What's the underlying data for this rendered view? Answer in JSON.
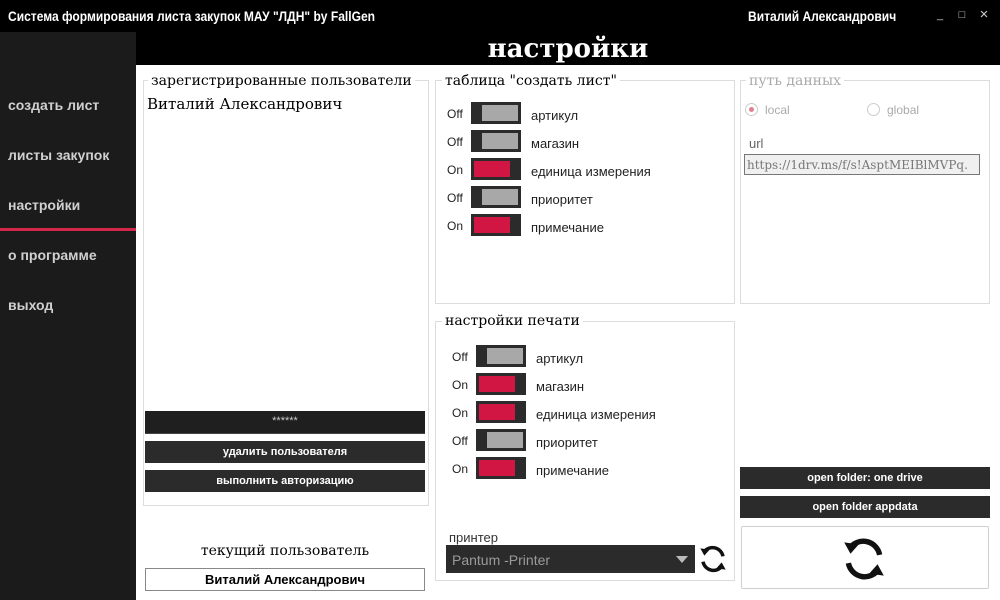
{
  "window": {
    "title": "Система формирования листа закупок МАУ \"ЛДН\" by FallGen",
    "user": "Виталий Александрович",
    "minimize": "_",
    "maximize": "□",
    "close": "×"
  },
  "sidebar": {
    "items": [
      {
        "label": "создать лист"
      },
      {
        "label": "листы закупок"
      },
      {
        "label": "настройки",
        "active": true
      },
      {
        "label": "о программе"
      },
      {
        "label": "выход"
      }
    ]
  },
  "header": {
    "title": "настройки"
  },
  "users_panel": {
    "legend": "зарегистрированные пользователи",
    "users": [
      "Виталий Александрович"
    ],
    "password_value": "******",
    "delete_button": "удалить пользователя",
    "auth_button": "выполнить авторизацию",
    "current_label": "текущий пользователь",
    "current_user": "Виталий Александрович"
  },
  "create_table": {
    "legend": "таблица \"создать лист\"",
    "rows": [
      {
        "state": "Off",
        "on": false,
        "label": "артикул"
      },
      {
        "state": "Off",
        "on": false,
        "label": "магазин"
      },
      {
        "state": "On",
        "on": true,
        "label": "единица измерения"
      },
      {
        "state": "Off",
        "on": false,
        "label": "приоритет"
      },
      {
        "state": "On",
        "on": true,
        "label": "примечание"
      }
    ]
  },
  "print_settings": {
    "legend": "настройки печати",
    "rows": [
      {
        "state": "Off",
        "on": false,
        "label": "артикул"
      },
      {
        "state": "On",
        "on": true,
        "label": "магазин"
      },
      {
        "state": "On",
        "on": true,
        "label": "единица измерения"
      },
      {
        "state": "Off",
        "on": false,
        "label": "приоритет"
      },
      {
        "state": "On",
        "on": true,
        "label": "примечание"
      }
    ],
    "printer_label": "принтер",
    "printer_value": "Pantum -Printer"
  },
  "data_path": {
    "legend": "путь данных",
    "local_label": "local",
    "global_label": "global",
    "selected": "local",
    "url_label": "url",
    "url_value": "https://1drv.ms/f/s!AsptMEIBlMVPq."
  },
  "buttons": {
    "open_onedrive": "open folder: one drive",
    "open_appdata": "open folder appdata"
  },
  "colors": {
    "accent": "#d21644",
    "toggle_off": "#a8a8a8",
    "dark": "#2b2b2b"
  }
}
